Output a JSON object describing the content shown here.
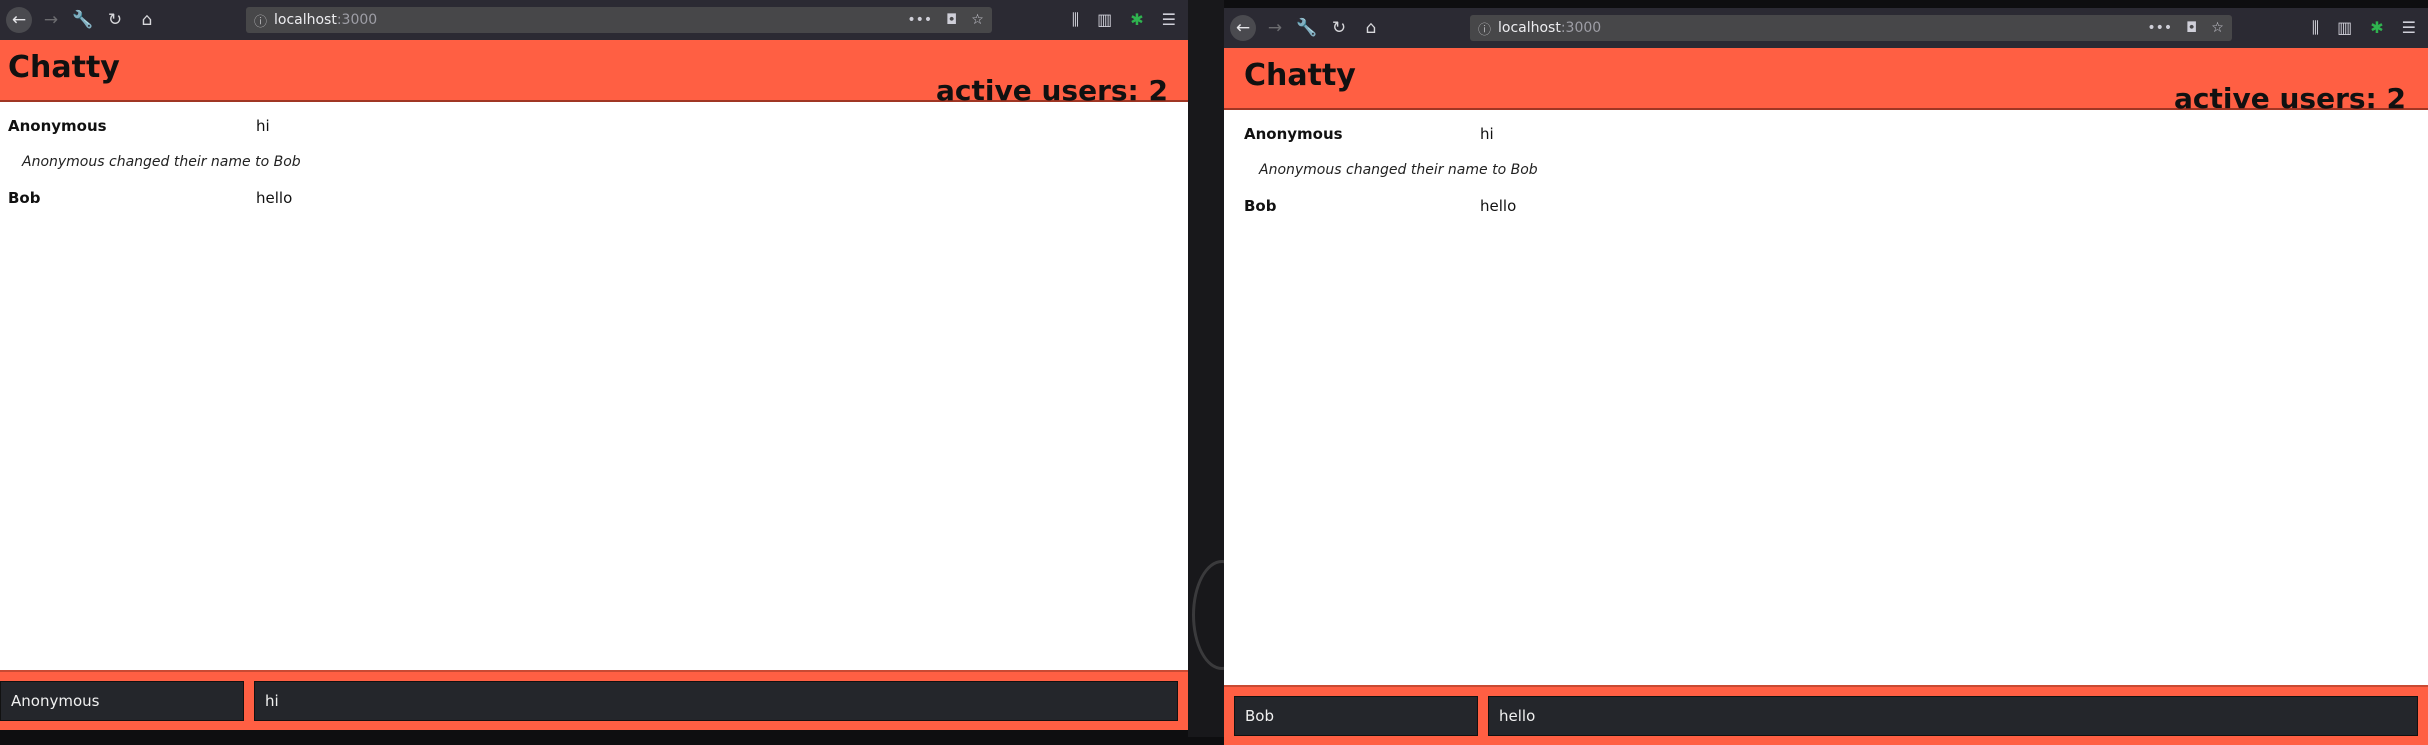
{
  "browser": {
    "url_host": "localhost",
    "url_port": ":3000"
  },
  "windows": [
    {
      "app": {
        "title": "Chatty",
        "active_users": "active users: 2"
      },
      "messages": [
        {
          "type": "message",
          "user": "Anonymous",
          "content": "hi"
        },
        {
          "type": "notification",
          "content": "Anonymous changed their name to Bob"
        },
        {
          "type": "message",
          "user": "Bob",
          "content": "hello"
        }
      ],
      "footer": {
        "username_value": "Anonymous",
        "message_value": "hi"
      }
    },
    {
      "app": {
        "title": "Chatty",
        "active_users": "active users: 2"
      },
      "messages": [
        {
          "type": "message",
          "user": "Anonymous",
          "content": "hi"
        },
        {
          "type": "notification",
          "content": "Anonymous changed their name to Bob"
        },
        {
          "type": "message",
          "user": "Bob",
          "content": "hello"
        }
      ],
      "footer": {
        "username_value": "Bob",
        "message_value": "hello"
      }
    }
  ],
  "colors": {
    "header_bg": "#ff5f43",
    "toolbar_bg": "#2b2a33",
    "input_bg": "#24262b"
  },
  "icons": {
    "back": "arrow-left-icon",
    "forward": "arrow-right-icon",
    "tools": "wrench-icon",
    "reload": "reload-icon",
    "home": "home-icon",
    "info": "info-icon",
    "more": "ellipsis-icon",
    "pocket": "pocket-icon",
    "bookmark": "star-icon",
    "library": "library-icon",
    "sidebar": "sidebar-icon",
    "extension": "extension-icon",
    "menu": "hamburger-menu-icon"
  }
}
